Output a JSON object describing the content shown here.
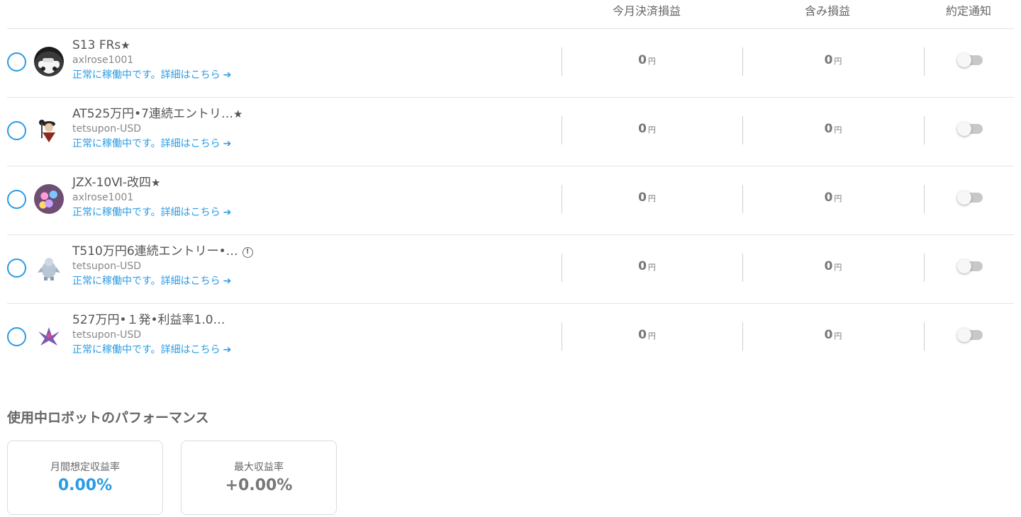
{
  "header": {
    "monthly_pl": "今月決済損益",
    "unrealized_pl": "含み損益",
    "execution_notice": "約定通知"
  },
  "robots": [
    {
      "title": "S13 FRs",
      "starred": "★",
      "user": "axlrose1001",
      "status": "正常に稼働中です。詳細はこちら",
      "monthly_pl": "0",
      "unrealized_pl": "0",
      "unit": "円",
      "notify": false
    },
    {
      "title": "AT525万円•7連続エントリ…",
      "starred": "★",
      "user": "tetsupon-USD",
      "status": "正常に稼働中です。詳細はこちら",
      "monthly_pl": "0",
      "unrealized_pl": "0",
      "unit": "円",
      "notify": false
    },
    {
      "title": "JZX-10Ⅵ-改四",
      "starred": "★",
      "user": "axlrose1001",
      "status": "正常に稼働中です。詳細はこちら",
      "monthly_pl": "0",
      "unrealized_pl": "0",
      "unit": "円",
      "notify": false
    },
    {
      "title": "T510万円6連続エントリー•…",
      "starred": "",
      "warning": "!",
      "user": "tetsupon-USD",
      "status": "正常に稼働中です。詳細はこちら",
      "monthly_pl": "0",
      "unrealized_pl": "0",
      "unit": "円",
      "notify": false
    },
    {
      "title": "527万円•１発•利益率1.0…",
      "starred": "",
      "user": "tetsupon-USD",
      "status": "正常に稼働中です。詳細はこちら",
      "monthly_pl": "0",
      "unrealized_pl": "0",
      "unit": "円",
      "notify": false
    }
  ],
  "performance": {
    "section_title": "使用中ロボットのパフォーマンス",
    "monthly_expected_label": "月間想定収益率",
    "monthly_expected_value": "0.00%",
    "max_return_label": "最大収益率",
    "max_return_value": "+0.00%"
  },
  "colors": {
    "accent": "#2a9be3",
    "text": "#555555",
    "border": "#e4e4e4"
  }
}
